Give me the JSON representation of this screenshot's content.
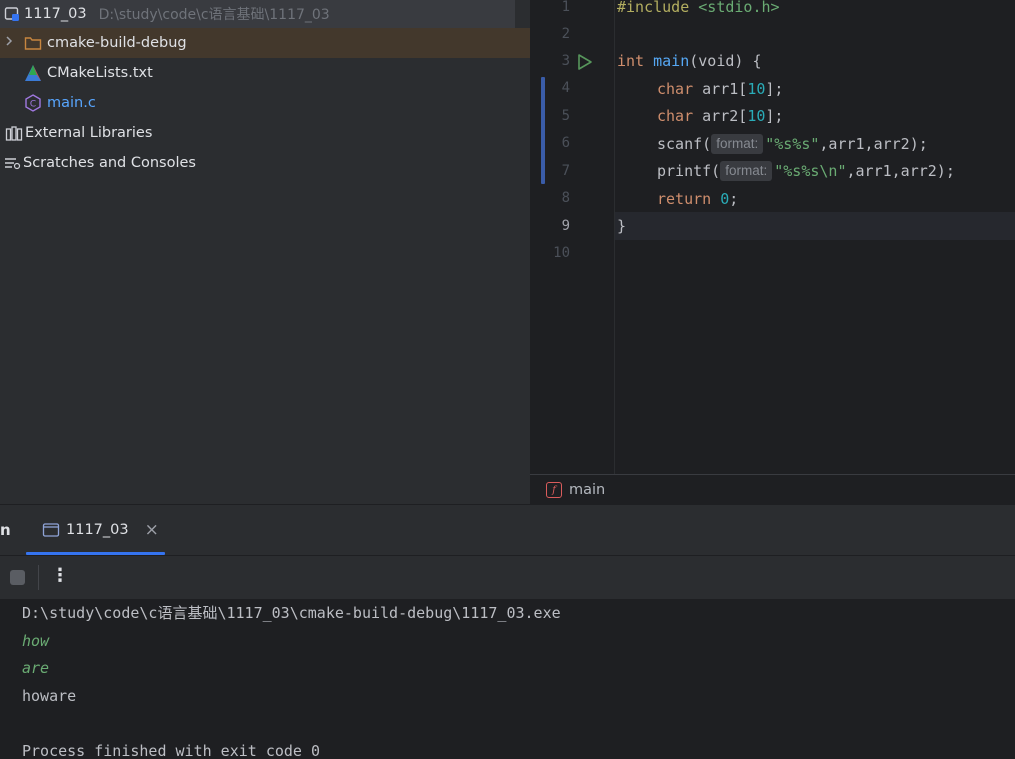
{
  "project": {
    "root_name": "1117_03",
    "root_path": "D:\\study\\code\\c语言基础\\1117_03",
    "items": [
      {
        "label": "cmake-build-debug",
        "icon": "folder-icon"
      },
      {
        "label": "CMakeLists.txt",
        "icon": "cmake-icon"
      },
      {
        "label": "main.c",
        "icon": "c-file-icon"
      },
      {
        "label": "External Libraries",
        "icon": "libraries-icon"
      },
      {
        "label": "Scratches and Consoles",
        "icon": "scratches-icon"
      }
    ]
  },
  "editor": {
    "line_numbers": [
      "1",
      "2",
      "3",
      "4",
      "5",
      "6",
      "7",
      "8",
      "9",
      "10"
    ],
    "lines": {
      "l1_directive": "#include",
      "l1_header": " <stdio.h>",
      "l3_type": "int",
      "l3_name": "main",
      "l3_rest": "(void) {",
      "l4_type": "char",
      "l4_rest_a": " arr1[",
      "l4_num": "10",
      "l4_rest_b": "];",
      "l5_type": "char",
      "l5_rest_a": " arr2[",
      "l5_num": "10",
      "l5_rest_b": "];",
      "l6_call": "scanf(",
      "l6_hint": "format:",
      "l6_str": "\"%s%s\"",
      "l6_rest": ",arr1,arr2);",
      "l7_call": "printf(",
      "l7_hint": "format:",
      "l7_str": "\"%s%s\\n\"",
      "l7_rest": ",arr1,arr2);",
      "l8_kw": "return",
      "l8_num": " 0",
      "l8_rest": ";",
      "l9": "}"
    },
    "breadcrumb": "main",
    "breadcrumb_badge": "f"
  },
  "run": {
    "panel_label": "n",
    "tab_label": "1117_03",
    "tab_close": "×",
    "more_glyph": "⋮"
  },
  "console": {
    "path": "D:\\study\\code\\c语言基础\\1117_03\\cmake-build-debug\\1117_03.exe",
    "input1": "how",
    "input2": "are",
    "output": "howare",
    "exit": "Process finished with exit code 0"
  },
  "colors": {
    "keyword": "#cf8e6d",
    "function": "#56a8f5",
    "number": "#2aacb8",
    "string": "#6aab73",
    "accent": "#3574f0"
  }
}
